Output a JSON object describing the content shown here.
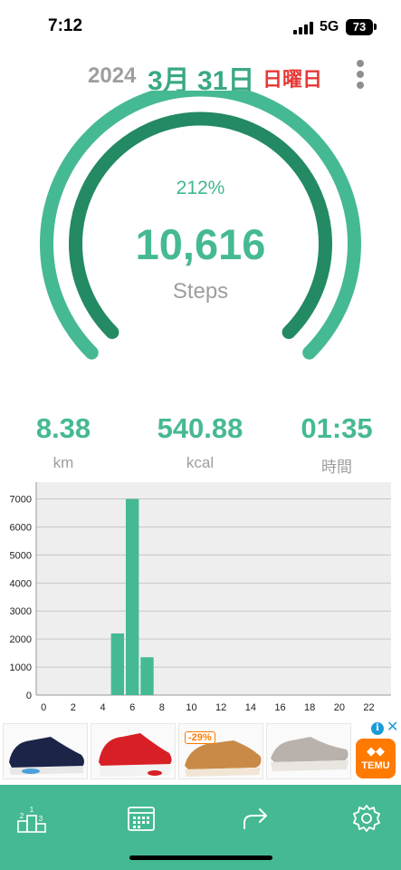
{
  "status_bar": {
    "time": "7:12",
    "network": "5G",
    "battery": "73"
  },
  "date": {
    "year": "2024",
    "month_day": "3月 31日",
    "weekday": "日曜日"
  },
  "progress": {
    "percent_label": "212%",
    "steps": "10,616",
    "steps_label": "Steps",
    "outer_ring_fraction": 1.0,
    "inner_ring_fraction": 1.0
  },
  "stats": [
    {
      "value": "8.38",
      "unit": "km"
    },
    {
      "value": "540.88",
      "unit": "kcal"
    },
    {
      "value": "01:35",
      "unit": "時間"
    }
  ],
  "chart_data": {
    "type": "bar",
    "x": [
      5,
      6,
      7
    ],
    "values": [
      2200,
      7000,
      1350
    ],
    "xlim": [
      -0.5,
      23.5
    ],
    "ylim": [
      0,
      7600
    ],
    "xticks": [
      0,
      2,
      4,
      6,
      8,
      10,
      12,
      14,
      16,
      18,
      20,
      22
    ],
    "yticks": [
      0,
      1000,
      2000,
      3000,
      4000,
      5000,
      6000,
      7000
    ],
    "grid": true,
    "bar_color": "#45b993",
    "plot_background": "#eeeeee",
    "title": "",
    "xlabel": "",
    "ylabel": ""
  },
  "ad": {
    "discount": "-29%",
    "brand": "TEMU",
    "info_icon": "info-icon",
    "close_icon": "close-icon"
  },
  "nav": [
    {
      "icon": "podium-ranking-icon"
    },
    {
      "icon": "calendar-icon"
    },
    {
      "icon": "share-arrow-icon"
    },
    {
      "icon": "gear-icon"
    }
  ],
  "colors": {
    "accent": "#45b993",
    "accent_dark": "#238a63",
    "weekday_red": "#e53935",
    "grey_text": "#9e9e9e"
  }
}
